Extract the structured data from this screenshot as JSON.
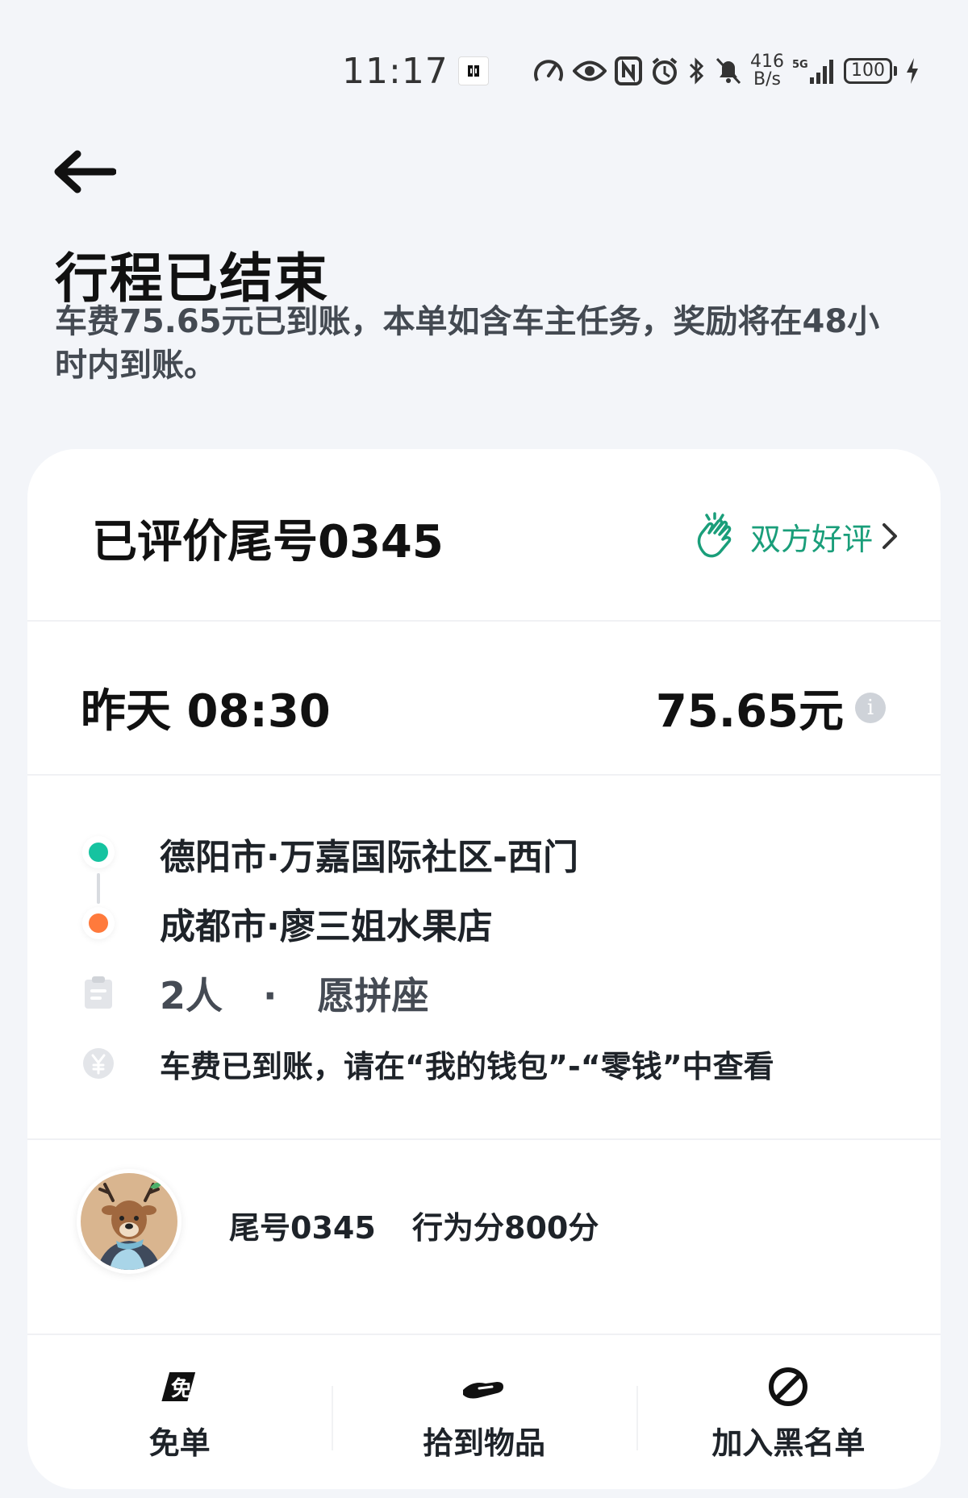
{
  "status_bar": {
    "time": "11:17",
    "net_speed_top": "416",
    "net_speed_bottom": "B/s",
    "network_type": "5G",
    "battery": "100"
  },
  "header": {
    "title": "行程已结束",
    "subtitle": "车费75.65元已到账，本单如含车主任务，奖励将在48小时内到账。"
  },
  "card": {
    "rated_title": "已评价尾号0345",
    "mutual_review_label": "双方好评",
    "trip_time": "昨天 08:30",
    "trip_fare": "75.65元",
    "info_icon_glyph": "i",
    "route": {
      "start": "德阳市·万嘉国际社区-西门",
      "end": "成都市·廖三姐水果店"
    },
    "passengers": {
      "count": "2人",
      "separator": "·",
      "mode": "愿拼座"
    },
    "payment_note": "车费已到账，请在“我的钱包”-“零钱”中查看",
    "driver": {
      "tail_number": "尾号0345",
      "behavior_score": "行为分800分"
    },
    "actions": [
      {
        "label": "免单",
        "icon": "free-ride-icon"
      },
      {
        "label": "拾到物品",
        "icon": "found-item-icon"
      },
      {
        "label": "加入黑名单",
        "icon": "block-icon"
      }
    ]
  },
  "colors": {
    "start_dot": "#16c3a0",
    "end_dot": "#ff7a3c",
    "accent_green": "#1a9e7a",
    "background": "#f3f5f9"
  }
}
